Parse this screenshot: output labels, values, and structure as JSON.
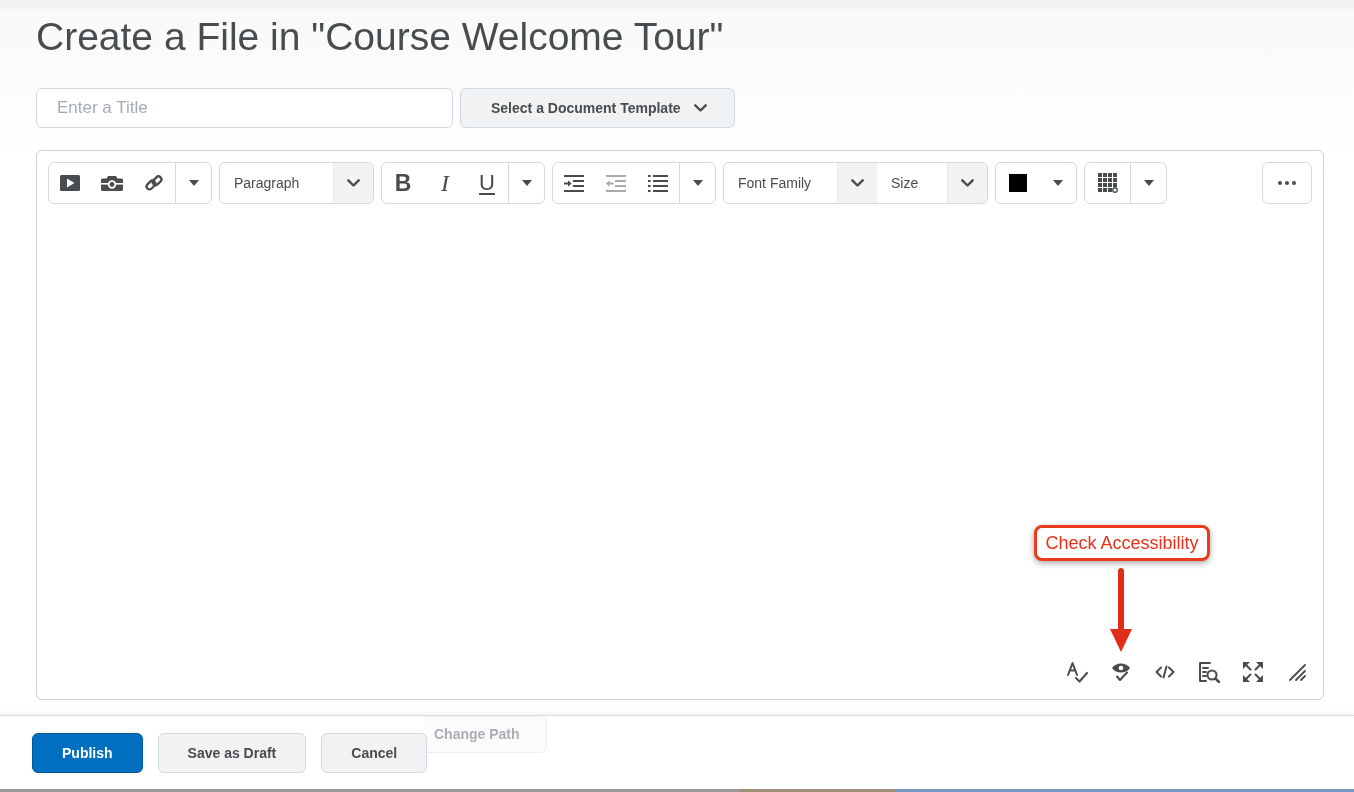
{
  "page": {
    "title": "Create a File in \"Course Welcome Tour\""
  },
  "title_field": {
    "placeholder": "Enter a Title"
  },
  "template_dropdown": {
    "label": "Select a Document Template"
  },
  "toolbar": {
    "block_format": {
      "value": "Paragraph"
    },
    "format_buttons": [
      {
        "label": "B",
        "kind": "bold"
      },
      {
        "label": "I",
        "kind": "italic"
      },
      {
        "label": "U",
        "kind": "underline"
      }
    ],
    "indent_buttons": [
      {
        "disabled": false
      },
      {
        "disabled": true
      },
      {
        "disabled": false
      }
    ],
    "font_family": {
      "value": "Font Family"
    },
    "font_size": {
      "value": "Size"
    }
  },
  "annotation": {
    "text": "Check Accessibility"
  },
  "change_path_button": {
    "label": "Change Path"
  },
  "footer_buttons": [
    {
      "label": "Publish",
      "kind": "primary"
    },
    {
      "label": "Save as Draft",
      "kind": "secondary"
    },
    {
      "label": "Cancel",
      "kind": "secondary"
    }
  ]
}
